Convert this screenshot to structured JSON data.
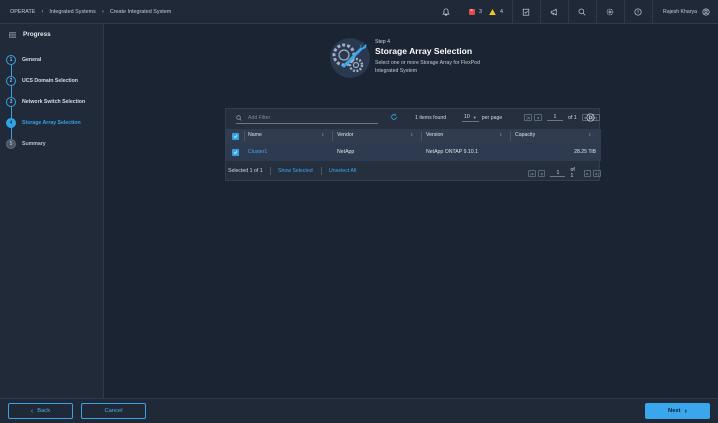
{
  "breadcrumb": {
    "root": "OPERATE",
    "parent": "Integrated Systems",
    "current": "Create Integrated System"
  },
  "header": {
    "critical_count": "3",
    "warning_count": "4",
    "user_name": "Rajesh Kharya"
  },
  "sidebar": {
    "title": "Progress",
    "steps": [
      {
        "num": "1",
        "label": "General"
      },
      {
        "num": "2",
        "label": "UCS Domain Selection"
      },
      {
        "num": "3",
        "label": "Network Switch Selection"
      },
      {
        "num": "4",
        "label": "Storage Array Selection"
      },
      {
        "num": "5",
        "label": "Summary"
      }
    ]
  },
  "step": {
    "sub": "Step 4",
    "title": "Storage Array Selection",
    "description": "Select one or more Storage Array for FlexPod Integrated System"
  },
  "table": {
    "filter_placeholder": "Add Filter",
    "items_found": "1 items found",
    "per_page_value": "10",
    "per_page_label": "per page",
    "page": "1",
    "of_pages": "of 1",
    "columns": [
      "Name",
      "Vendor",
      "Version",
      "Capacity"
    ],
    "rows": [
      {
        "name": "Cluster1",
        "vendor": "NetApp",
        "version": "NetApp ONTAP 9.10.1",
        "capacity": "28.25 TiB"
      }
    ],
    "selected_info": "Selected 1 of 1",
    "show_selected": "Show Selected",
    "unselect_all": "Unselect All"
  },
  "footer": {
    "back": "Back",
    "cancel": "Cancel",
    "next": "Next"
  },
  "colors": {
    "accent": "#34a3e6",
    "critical": "#e5484d",
    "warning": "#f5c518"
  }
}
